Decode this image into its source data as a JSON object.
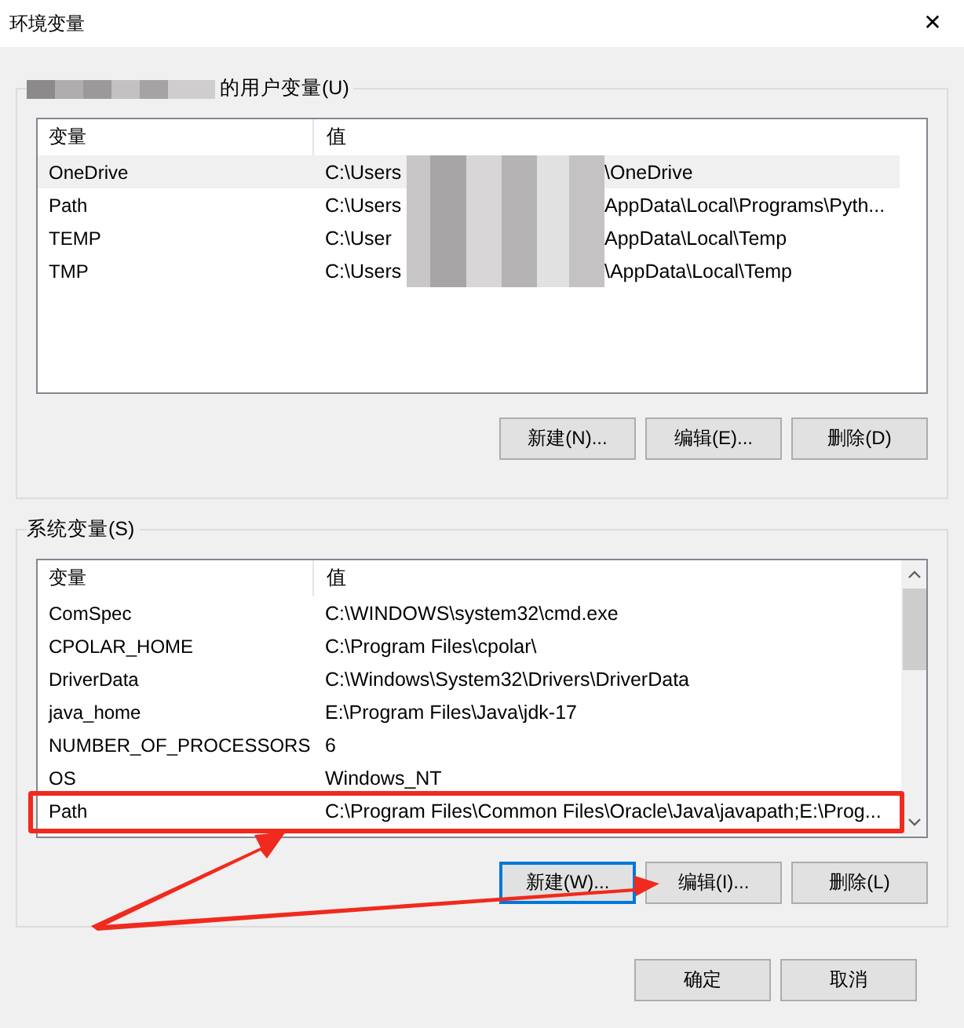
{
  "window": {
    "title": "环境变量",
    "close": "✕"
  },
  "user_vars": {
    "legend": "的用户变量(U)",
    "columns": [
      "变量",
      "值"
    ],
    "rows": [
      {
        "name": "OneDrive",
        "value_start": "C:\\Users",
        "value_end": "\\OneDrive",
        "selected": true
      },
      {
        "name": "Path",
        "value_start": "C:\\Users",
        "value_end": "AppData\\Local\\Programs\\Pyth...",
        "selected": false
      },
      {
        "name": "TEMP",
        "value_start": "C:\\User",
        "value_end": "AppData\\Local\\Temp",
        "selected": false
      },
      {
        "name": "TMP",
        "value_start": "C:\\Users",
        "value_end": "\\AppData\\Local\\Temp",
        "selected": false
      }
    ],
    "buttons": [
      "新建(N)...",
      "编辑(E)...",
      "删除(D)"
    ]
  },
  "system_vars": {
    "legend": "系统变量(S)",
    "columns": [
      "变量",
      "值"
    ],
    "rows": [
      {
        "name": "ComSpec",
        "value": "C:\\WINDOWS\\system32\\cmd.exe",
        "highlighted": false
      },
      {
        "name": "CPOLAR_HOME",
        "value": "C:\\Program Files\\cpolar\\",
        "highlighted": false
      },
      {
        "name": "DriverData",
        "value": "C:\\Windows\\System32\\Drivers\\DriverData",
        "highlighted": false
      },
      {
        "name": "java_home",
        "value": "E:\\Program Files\\Java\\jdk-17",
        "highlighted": false
      },
      {
        "name": "NUMBER_OF_PROCESSORS",
        "value": "6",
        "highlighted": false
      },
      {
        "name": "OS",
        "value": "Windows_NT",
        "highlighted": false
      },
      {
        "name": "Path",
        "value": "C:\\Program Files\\Common Files\\Oracle\\Java\\javapath;E:\\Prog...",
        "highlighted": true
      }
    ],
    "buttons": [
      {
        "label": "新建(W)...",
        "focused": true
      },
      {
        "label": "编辑(I)...",
        "focused": false
      },
      {
        "label": "删除(L)",
        "focused": false
      }
    ]
  },
  "footer_buttons": [
    "确定",
    "取消"
  ]
}
